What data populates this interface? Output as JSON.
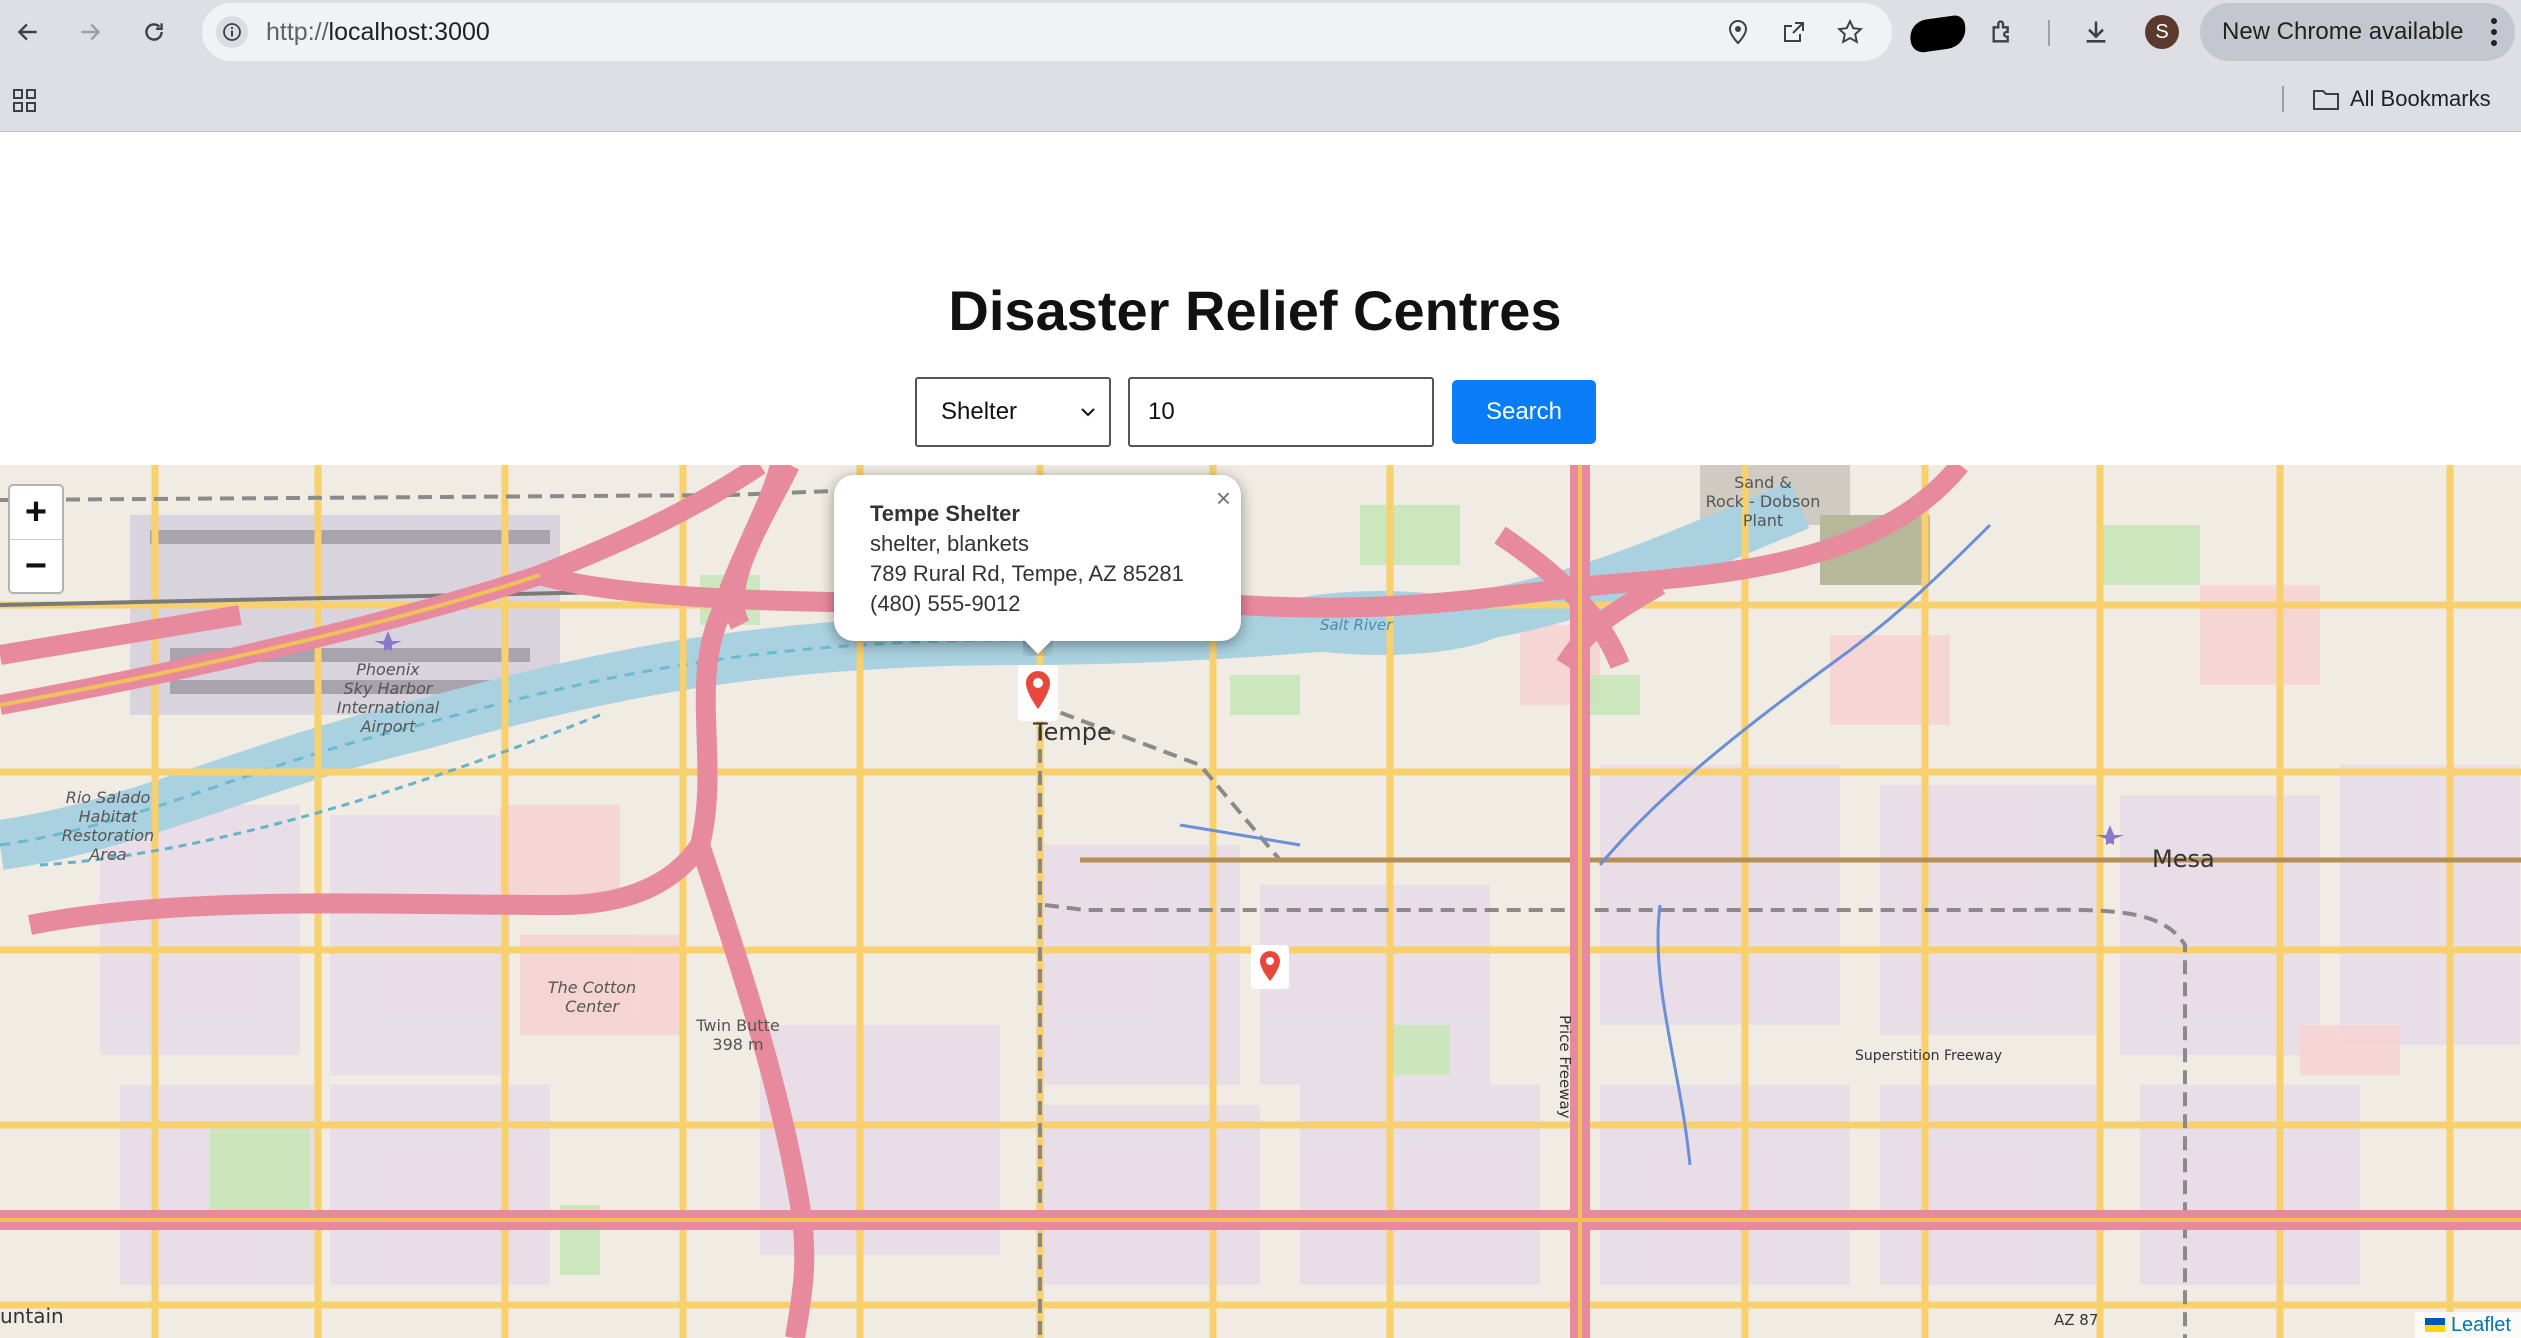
{
  "browser": {
    "url_scheme": "http://",
    "url_host": "localhost:3000",
    "new_chrome_label": "New Chrome available",
    "avatar_letter": "S",
    "all_bookmarks_label": "All Bookmarks"
  },
  "page": {
    "title": "Disaster Relief Centres",
    "type_select_value": "Shelter",
    "radius_value": "10",
    "search_label": "Search"
  },
  "map": {
    "zoom_in": "+",
    "zoom_out": "−",
    "attribution": "Leaflet",
    "labels": {
      "tempe": "Tempe",
      "mesa": "Mesa",
      "airport_1": "Phoenix",
      "airport_2": "Sky Harbor",
      "airport_3": "International",
      "airport_4": "Airport",
      "rio_1": "Rio Salado",
      "rio_2": "Habitat",
      "rio_3": "Restoration",
      "rio_4": "Area",
      "cotton_1": "The Cotton",
      "cotton_2": "Center",
      "twin_1": "Twin Butte",
      "twin_2": "398 m",
      "sand_1": "Sand &",
      "sand_2": "Rock - Dobson",
      "sand_3": "Plant",
      "salt_river": "Salt River",
      "price_freeway": "Price Freeway",
      "superstition": "Superstition Freeway",
      "az87": "AZ 87",
      "mountain": "untain"
    },
    "popup": {
      "name": "Tempe Shelter",
      "services": "shelter, blankets",
      "address": "789 Rural Rd, Tempe, AZ 85281",
      "phone": "(480) 555-9012",
      "close": "×"
    },
    "colors": {
      "accent": "#0a7cf7",
      "marker": "#e8473b",
      "highway": "#e892a2",
      "arterial": "#fcd66a",
      "water": "#aad3df"
    }
  }
}
